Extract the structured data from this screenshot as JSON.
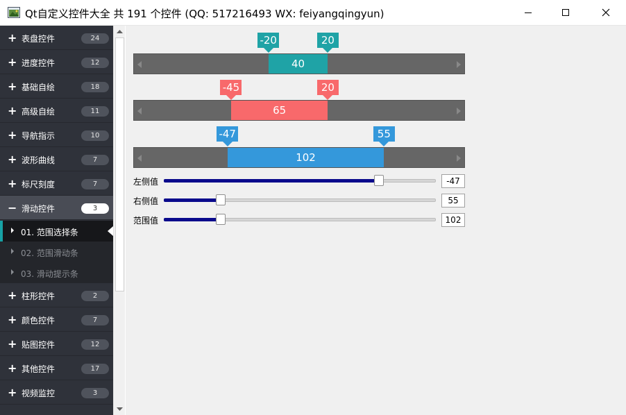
{
  "window": {
    "title": "Qt自定义控件大全 共 191 个控件 (QQ: 517216493 WX: feiyangqingyun)"
  },
  "sidebar": {
    "categories_top": [
      {
        "sign": "+",
        "label": "表盘控件",
        "count": "24"
      },
      {
        "sign": "+",
        "label": "进度控件",
        "count": "12"
      },
      {
        "sign": "+",
        "label": "基础自绘",
        "count": "18"
      },
      {
        "sign": "+",
        "label": "高级自绘",
        "count": "11"
      },
      {
        "sign": "+",
        "label": "导航指示",
        "count": "10"
      },
      {
        "sign": "+",
        "label": "波形曲线",
        "count": "7"
      },
      {
        "sign": "+",
        "label": "标尺刻度",
        "count": "7"
      },
      {
        "sign": "−",
        "label": "滑动控件",
        "count": "3"
      }
    ],
    "sub_items": [
      {
        "label": "01. 范围选择条",
        "selected": true
      },
      {
        "label": "02. 范围滑动条",
        "selected": false
      },
      {
        "label": "03. 滑动提示条",
        "selected": false
      }
    ],
    "categories_bottom": [
      {
        "sign": "+",
        "label": "柱形控件",
        "count": "2"
      },
      {
        "sign": "+",
        "label": "颜色控件",
        "count": "7"
      },
      {
        "sign": "+",
        "label": "贴图控件",
        "count": "12"
      },
      {
        "sign": "+",
        "label": "其他控件",
        "count": "17"
      },
      {
        "sign": "+",
        "label": "视频监控",
        "count": "3"
      }
    ]
  },
  "range_bars": [
    {
      "left": "-20",
      "right": "20",
      "range": "40",
      "color": "#1fa3a6",
      "left_fraction": 0.407,
      "right_fraction": 0.587
    },
    {
      "left": "-45",
      "right": "20",
      "range": "65",
      "color": "#f8696b",
      "left_fraction": 0.294,
      "right_fraction": 0.587
    },
    {
      "left": "-47",
      "right": "55",
      "range": "102",
      "color": "#3498db",
      "left_fraction": 0.283,
      "right_fraction": 0.757
    }
  ],
  "controls": [
    {
      "label": "左侧值",
      "value": "-47",
      "fraction": 0.79
    },
    {
      "label": "右侧值",
      "value": "55",
      "fraction": 0.21
    },
    {
      "label": "范围值",
      "value": "102",
      "fraction": 0.21
    }
  ],
  "colors": {
    "sidebar_bg": "#2f323a",
    "accent": "#17a2a5",
    "slider_fill": "#0a0a8c"
  }
}
